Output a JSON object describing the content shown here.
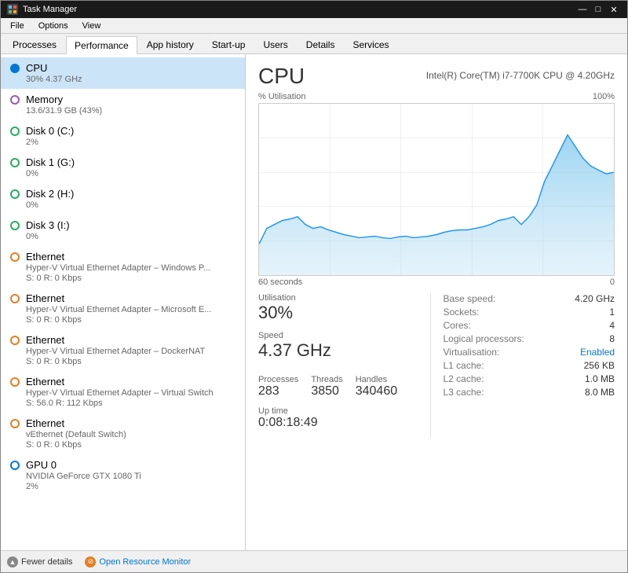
{
  "window": {
    "title": "Task Manager",
    "controls": {
      "minimize": "—",
      "maximize": "□",
      "close": "✕"
    }
  },
  "menu": {
    "items": [
      "File",
      "Options",
      "View"
    ]
  },
  "tabs": {
    "items": [
      "Processes",
      "Performance",
      "App history",
      "Start-up",
      "Users",
      "Details",
      "Services"
    ],
    "active": "Performance"
  },
  "sidebar": {
    "items": [
      {
        "id": "cpu",
        "label": "CPU",
        "sub": "30%  4.37 GHz",
        "dot": "blue-filled",
        "active": true
      },
      {
        "id": "memory",
        "label": "Memory",
        "sub": "13.6/31.9 GB (43%)",
        "dot": "purple"
      },
      {
        "id": "disk0",
        "label": "Disk 0 (C:)",
        "sub": "2%",
        "dot": "green"
      },
      {
        "id": "disk1",
        "label": "Disk 1 (G:)",
        "sub": "0%",
        "dot": "green"
      },
      {
        "id": "disk2",
        "label": "Disk 2 (H:)",
        "sub": "0%",
        "dot": "green"
      },
      {
        "id": "disk3",
        "label": "Disk 3 (I:)",
        "sub": "0%",
        "dot": "green"
      },
      {
        "id": "eth1",
        "label": "Ethernet",
        "sub2": "Hyper-V Virtual Ethernet Adapter – Windows P...",
        "sub3": "S: 0 R: 0 Kbps",
        "dot": "orange"
      },
      {
        "id": "eth2",
        "label": "Ethernet",
        "sub2": "Hyper-V Virtual Ethernet Adapter – Microsoft E...",
        "sub3": "S: 0 R: 0 Kbps",
        "dot": "orange"
      },
      {
        "id": "eth3",
        "label": "Ethernet",
        "sub2": "Hyper-V Virtual Ethernet Adapter – DockerNAT",
        "sub3": "S: 0 R: 0 Kbps",
        "dot": "orange"
      },
      {
        "id": "eth4",
        "label": "Ethernet",
        "sub2": "Hyper-V Virtual Ethernet Adapter – Virtual Switch",
        "sub3": "S: 56.0  R: 112 Kbps",
        "dot": "orange"
      },
      {
        "id": "eth5",
        "label": "Ethernet",
        "sub2": "vEthernet (Default Switch)",
        "sub3": "S: 0 R: 0 Kbps",
        "dot": "orange"
      },
      {
        "id": "gpu0",
        "label": "GPU 0",
        "sub2": "NVIDIA GeForce GTX 1080 Ti",
        "sub3": "2%",
        "dot": "blue-outline"
      }
    ]
  },
  "main": {
    "cpu_title": "CPU",
    "cpu_model": "Intel(R) Core(TM) i7-7700K CPU @ 4.20GHz",
    "chart_label_y": "% Utilisation",
    "chart_label_y_max": "100%",
    "chart_label_x_left": "60 seconds",
    "chart_label_x_right": "0",
    "stats": {
      "utilisation_label": "Utilisation",
      "utilisation_value": "30%",
      "speed_label": "Speed",
      "speed_value": "4.37 GHz",
      "processes_label": "Processes",
      "processes_value": "283",
      "threads_label": "Threads",
      "threads_value": "3850",
      "handles_label": "Handles",
      "handles_value": "340460",
      "uptime_label": "Up time",
      "uptime_value": "0:08:18:49"
    },
    "specs": {
      "base_speed_label": "Base speed:",
      "base_speed_value": "4.20 GHz",
      "sockets_label": "Sockets:",
      "sockets_value": "1",
      "cores_label": "Cores:",
      "cores_value": "4",
      "logical_label": "Logical processors:",
      "logical_value": "8",
      "virt_label": "Virtualisation:",
      "virt_value": "Enabled",
      "l1_label": "L1 cache:",
      "l1_value": "256 KB",
      "l2_label": "L2 cache:",
      "l2_value": "1.0 MB",
      "l3_label": "L3 cache:",
      "l3_value": "8.0 MB"
    }
  },
  "footer": {
    "fewer_details": "Fewer details",
    "open_resource_monitor": "Open Resource Monitor"
  }
}
